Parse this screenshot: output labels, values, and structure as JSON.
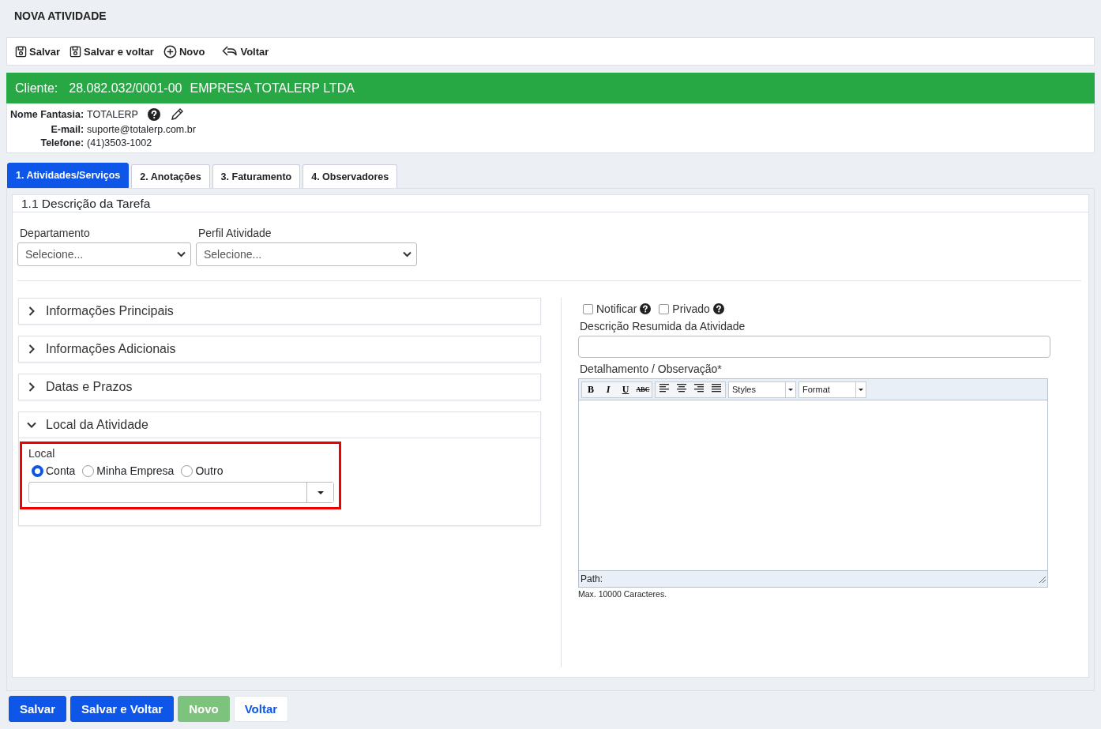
{
  "page_title": "NOVA ATIVIDADE",
  "toolbar": [
    {
      "kind": "save",
      "label": "Salvar"
    },
    {
      "kind": "save",
      "label": "Salvar e voltar"
    },
    {
      "kind": "new",
      "label": "Novo"
    },
    {
      "kind": "back",
      "label": "Voltar"
    }
  ],
  "client": {
    "label": "Cliente:",
    "document": "28.082.032/0001-00",
    "name": "EMPRESA TOTALERP LTDA"
  },
  "client_info": [
    {
      "label": "Nome Fantasia:",
      "value": "TOTALERP",
      "kind": "fantasy"
    },
    {
      "label": "E-mail:",
      "value": "suporte@totalerp.com.br",
      "kind": "plain"
    },
    {
      "label": "Telefone:",
      "value": "(41)3503-1002",
      "kind": "plain"
    }
  ],
  "tabs": [
    {
      "label": "1. Atividades/Serviços",
      "selected": true
    },
    {
      "label": "2. Anotações",
      "selected": false
    },
    {
      "label": "3. Faturamento",
      "selected": false
    },
    {
      "label": "4. Observadores",
      "selected": false
    }
  ],
  "section_title": "1.1 Descrição da Tarefa",
  "selects": [
    {
      "label": "Departamento",
      "value": "Selecione..."
    },
    {
      "label": "Perfil Atividade",
      "value": "Selecione..."
    }
  ],
  "accordion": [
    {
      "title": "Informações Principais",
      "expanded": false
    },
    {
      "title": "Informações Adicionais",
      "expanded": false
    },
    {
      "title": "Datas e Prazos",
      "expanded": false
    },
    {
      "title": "Local da Atividade",
      "expanded": true
    }
  ],
  "local": {
    "label": "Local",
    "highlighted": true,
    "options": [
      {
        "label": "Conta",
        "selected": true
      },
      {
        "label": "Minha Empresa",
        "selected": false
      },
      {
        "label": "Outro",
        "selected": false
      }
    ]
  },
  "checkboxes": [
    {
      "label": "Notificar",
      "checked": false
    },
    {
      "label": "Privado",
      "checked": false
    }
  ],
  "summary_label": "Descrição Resumida da Atividade",
  "detail_label": "Detalhamento / Observação*",
  "editor": {
    "format_buttons": [
      {
        "kind": "bold",
        "label": "B"
      },
      {
        "kind": "italic",
        "label": "I"
      },
      {
        "kind": "underline",
        "label": "U"
      },
      {
        "kind": "strike",
        "label": "ABC"
      }
    ],
    "align_buttons": [
      {
        "kind": "left"
      },
      {
        "kind": "center"
      },
      {
        "kind": "right"
      },
      {
        "kind": "justify"
      }
    ],
    "dropdowns": [
      "Styles",
      "Format"
    ],
    "path": "Path:",
    "limit": "Max. 10000 Caracteres."
  },
  "bottom_buttons": [
    {
      "kind": "primary",
      "label": "Salvar"
    },
    {
      "kind": "primary",
      "label": "Salvar e Voltar"
    },
    {
      "kind": "success",
      "label": "Novo"
    },
    {
      "kind": "light",
      "label": "Voltar"
    }
  ]
}
